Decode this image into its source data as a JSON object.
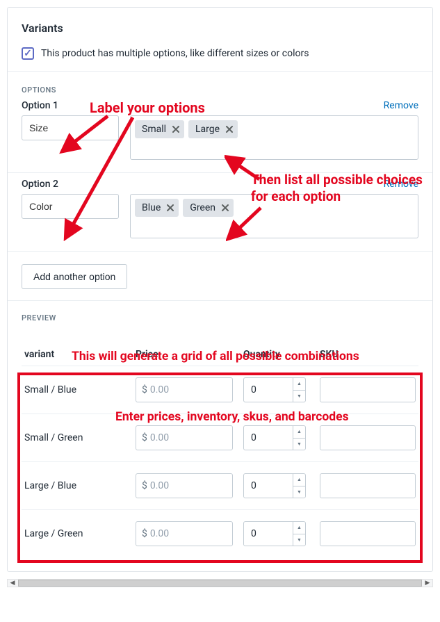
{
  "annotations": {
    "label_options": "Label your options",
    "then_list": "Then list all possible choices for each option",
    "generate_grid": "This will generate a grid of all possible combinations",
    "enter_prices": "Enter prices, inventory, skus, and barcodes"
  },
  "variants": {
    "title": "Variants",
    "checkbox_label": "This product has multiple options, like different sizes or colors",
    "checked": true
  },
  "options_heading": "OPTIONS",
  "remove_label": "Remove",
  "add_button_label": "Add another option",
  "options": [
    {
      "header": "Option 1",
      "name": "Size",
      "values": [
        "Small",
        "Large"
      ]
    },
    {
      "header": "Option 2",
      "name": "Color",
      "values": [
        "Blue",
        "Green"
      ]
    }
  ],
  "preview_heading": "PREVIEW",
  "columns": {
    "variant": "variant",
    "price": "Price",
    "quantity": "Quantity",
    "sku": "SKU"
  },
  "price_prefix": "$",
  "rows": [
    {
      "variant": "Small / Blue",
      "price": "0.00",
      "quantity": "0",
      "sku": ""
    },
    {
      "variant": "Small / Green",
      "price": "0.00",
      "quantity": "0",
      "sku": ""
    },
    {
      "variant": "Large / Blue",
      "price": "0.00",
      "quantity": "0",
      "sku": ""
    },
    {
      "variant": "Large / Green",
      "price": "0.00",
      "quantity": "0",
      "sku": ""
    }
  ]
}
